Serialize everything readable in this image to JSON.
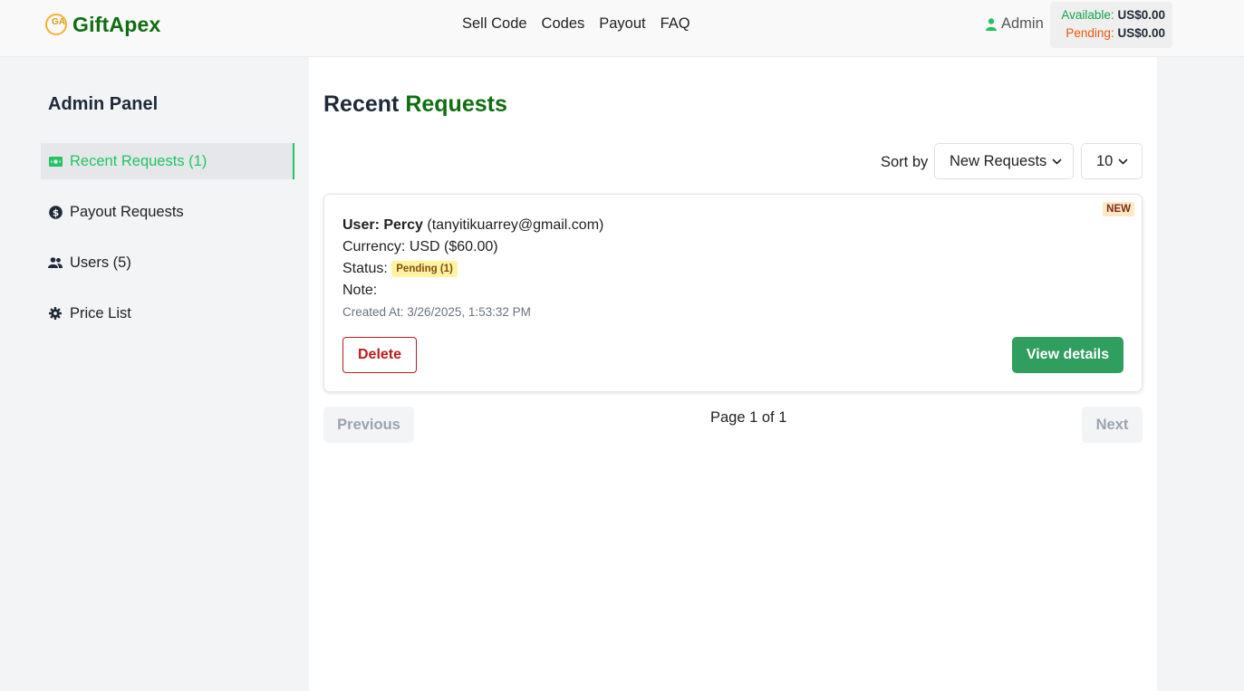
{
  "header": {
    "logo_mark": "GA",
    "brand": "GiftApex",
    "nav": [
      "Sell Code",
      "Codes",
      "Payout",
      "FAQ"
    ],
    "user_label": "Admin",
    "balance": {
      "available_label": "Available:",
      "available_value": "US$0.00",
      "pending_label": "Pending:",
      "pending_value": "US$0.00"
    }
  },
  "sidebar": {
    "title": "Admin Panel",
    "items": [
      {
        "label": "Recent Requests (1)",
        "icon": "money-icon",
        "active": true
      },
      {
        "label": "Payout Requests",
        "icon": "dollar-circle-icon",
        "active": false
      },
      {
        "label": "Users (5)",
        "icon": "users-icon",
        "active": false
      },
      {
        "label": "Price List",
        "icon": "gear-icon",
        "active": false
      }
    ]
  },
  "main": {
    "title_prefix": "Recent",
    "title_accent": "Requests",
    "sort_label": "Sort by",
    "sort_value": "New Requests",
    "per_page_value": "10",
    "requests": [
      {
        "badge": "NEW",
        "user_label": "User:",
        "user_name": "Percy",
        "user_email": "(tanyitikuarrey@gmail.com)",
        "currency_label": "Currency:",
        "currency_value": "USD ($60.00)",
        "status_label": "Status:",
        "status_value": "Pending (1)",
        "note_label": "Note:",
        "note_value": "",
        "created_at": "Created At: 3/26/2025, 1:53:32 PM",
        "delete_label": "Delete",
        "view_label": "View details"
      }
    ],
    "pagination": {
      "previous_label": "Previous",
      "page_info": "Page 1 of 1",
      "next_label": "Next"
    }
  },
  "colors": {
    "brand_green": "#0f6e0f",
    "active_green": "#22c55e",
    "view_button": "#2f9e5e",
    "delete_red": "#b91c1c",
    "pending_orange": "#ea580c"
  }
}
